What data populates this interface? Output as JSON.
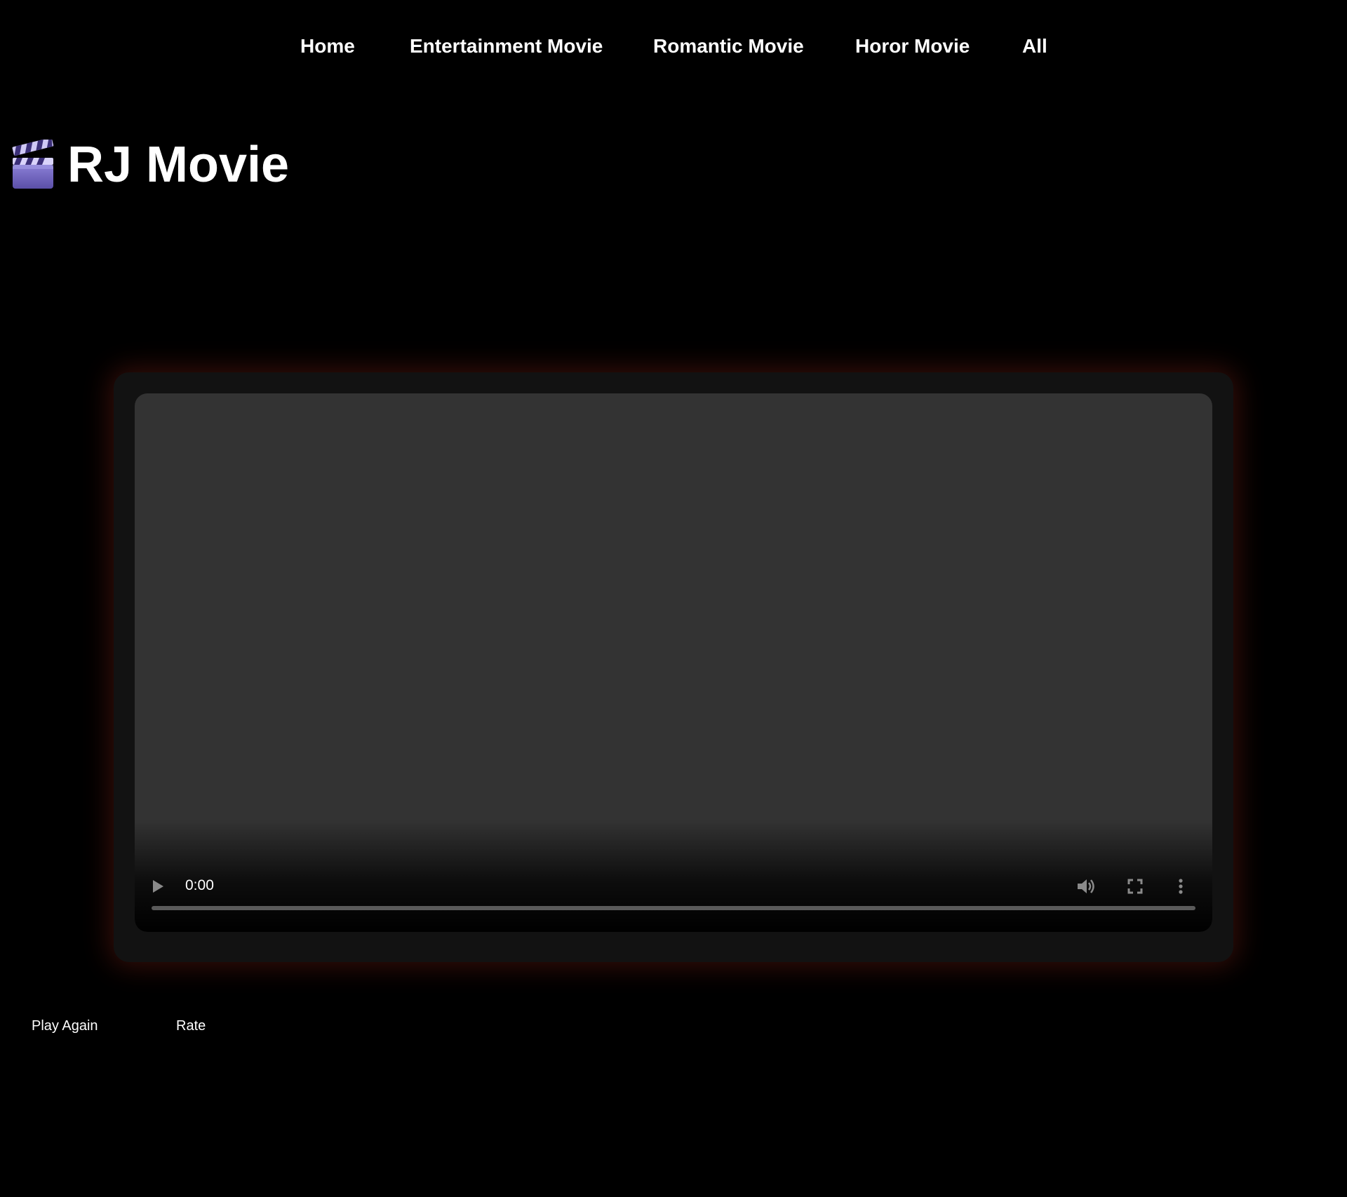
{
  "nav": {
    "items": [
      {
        "label": "Home"
      },
      {
        "label": "Entertainment Movie"
      },
      {
        "label": "Romantic Movie"
      },
      {
        "label": "Horor Movie"
      },
      {
        "label": "All"
      }
    ]
  },
  "brand": {
    "icon": "clapperboard-icon",
    "title": "RJ Movie"
  },
  "player": {
    "current_time": "0:00",
    "progress": 0,
    "icons": [
      "play-icon",
      "volume-icon",
      "fullscreen-icon",
      "more-options-icon"
    ]
  },
  "actions": {
    "play_again_label": "Play Again",
    "rate_label": "Rate"
  },
  "colors": {
    "background": "#000000",
    "frame": "#121212",
    "video": "#333333",
    "glow": "#781e14",
    "text": "#ffffff"
  }
}
